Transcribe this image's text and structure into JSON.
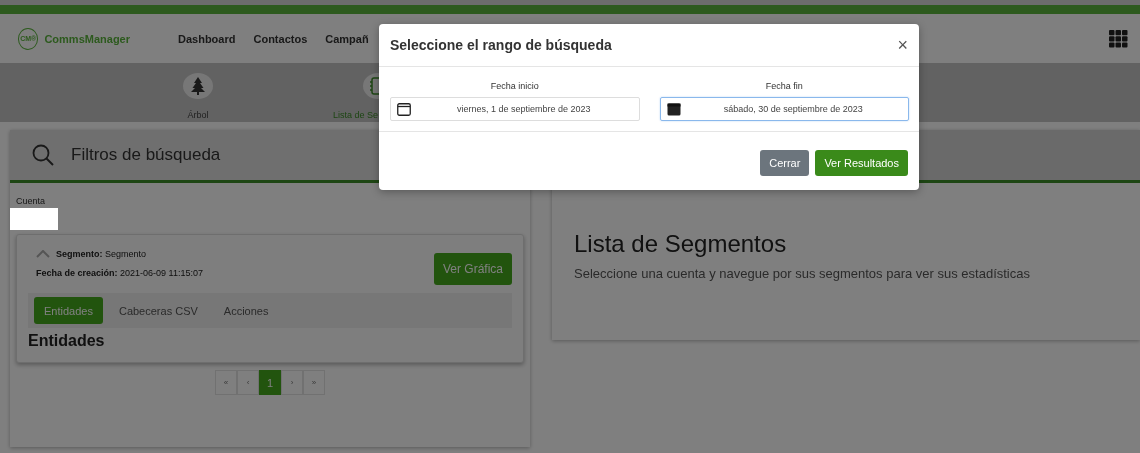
{
  "navbar": {
    "logo_mark": "CM®",
    "brand": "CommsManager",
    "links": [
      "Dashboard",
      "Contactos",
      "Campañ"
    ]
  },
  "subnav": {
    "items": [
      {
        "label": "Árbol",
        "kind": "tree",
        "selected": false
      },
      {
        "label": "Lista de Se",
        "kind": "list",
        "selected": true
      }
    ]
  },
  "filters": {
    "title": "Filtros de búsqueda",
    "account_label": "Cuenta",
    "segment": {
      "expanded": true,
      "name_line": "**Segmento:** Segmento",
      "date_line": "**Fecha de creación:** 2021-06-09 11:15:07",
      "chart_button": "Ver Gráfica",
      "tabs": [
        {
          "label": "Entidades",
          "selected": true
        },
        {
          "label": "Cabeceras CSV",
          "selected": false
        },
        {
          "label": "Acciones",
          "selected": false
        }
      ],
      "section_title": "Entidades"
    },
    "pagination": [
      {
        "label": "«",
        "selected": false
      },
      {
        "label": "‹",
        "selected": false
      },
      {
        "label": "1",
        "selected": true
      },
      {
        "label": "›",
        "selected": false
      },
      {
        "label": "»",
        "selected": false
      }
    ]
  },
  "segments": {
    "title": "Lista de Segmentos",
    "text": "Seleccione una cuenta y navegue por sus segmentos para ver sus estadísticas"
  },
  "modal": {
    "title": "Seleccione el rango de búsqueda",
    "close": "×",
    "fields": [
      {
        "label": "Fecha inicio",
        "value": "viernes, 1 de septiembre de 2023",
        "focused": false
      },
      {
        "label": "Fecha fin",
        "value": "sábado, 30 de septiembre de 2023",
        "focused": true
      }
    ],
    "buttons": [
      {
        "label": "Cerrar",
        "kind": "secondary"
      },
      {
        "label": "Ver Resultados",
        "kind": "primary"
      }
    ]
  }
}
